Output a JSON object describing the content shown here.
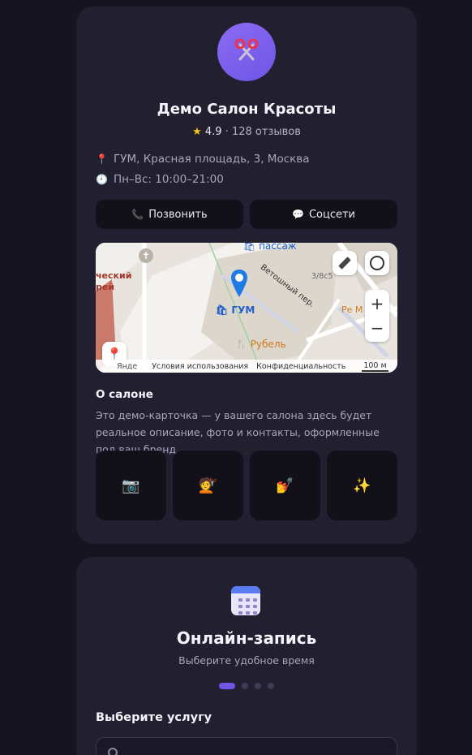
{
  "salon": {
    "name": "Демо Салон Красоты",
    "rating": "4.9",
    "reviews": "· 128 отзывов",
    "address": "ГУМ, Красная площадь, 3, Москва",
    "hours": "Пн–Вс: 10:00–21:00",
    "call_label": "Позвонить",
    "social_label": "Соцсети"
  },
  "map": {
    "labels": {
      "passage": "пассаж",
      "street": "Ветошный пер.",
      "house": "3/8с5",
      "gum": "ГУМ",
      "rubel": "Рубель",
      "right_poi": "Ре М",
      "left_poi": "ческий рей"
    },
    "terms": "Условия использования",
    "privacy": "Конфиденциальность",
    "scale": "100 м",
    "yandex": "Янде",
    "zoom_in": "+",
    "zoom_out": "−"
  },
  "about": {
    "heading": "О салоне",
    "text": "Это демо-карточка — у вашего салона здесь будет реальное описание, фото и контакты, оформленные под ваш бренд."
  },
  "gallery": {
    "icons": [
      "📷",
      "💇",
      "💅",
      "✨"
    ]
  },
  "booking": {
    "title": "Онлайн-запись",
    "subtitle": "Выберите удобное время",
    "step": 1,
    "steps_total": 4,
    "service_heading": "Выберите услугу"
  },
  "colors": {
    "accent": "#6f54e6",
    "background": "#16141f",
    "card": "#221f30"
  }
}
